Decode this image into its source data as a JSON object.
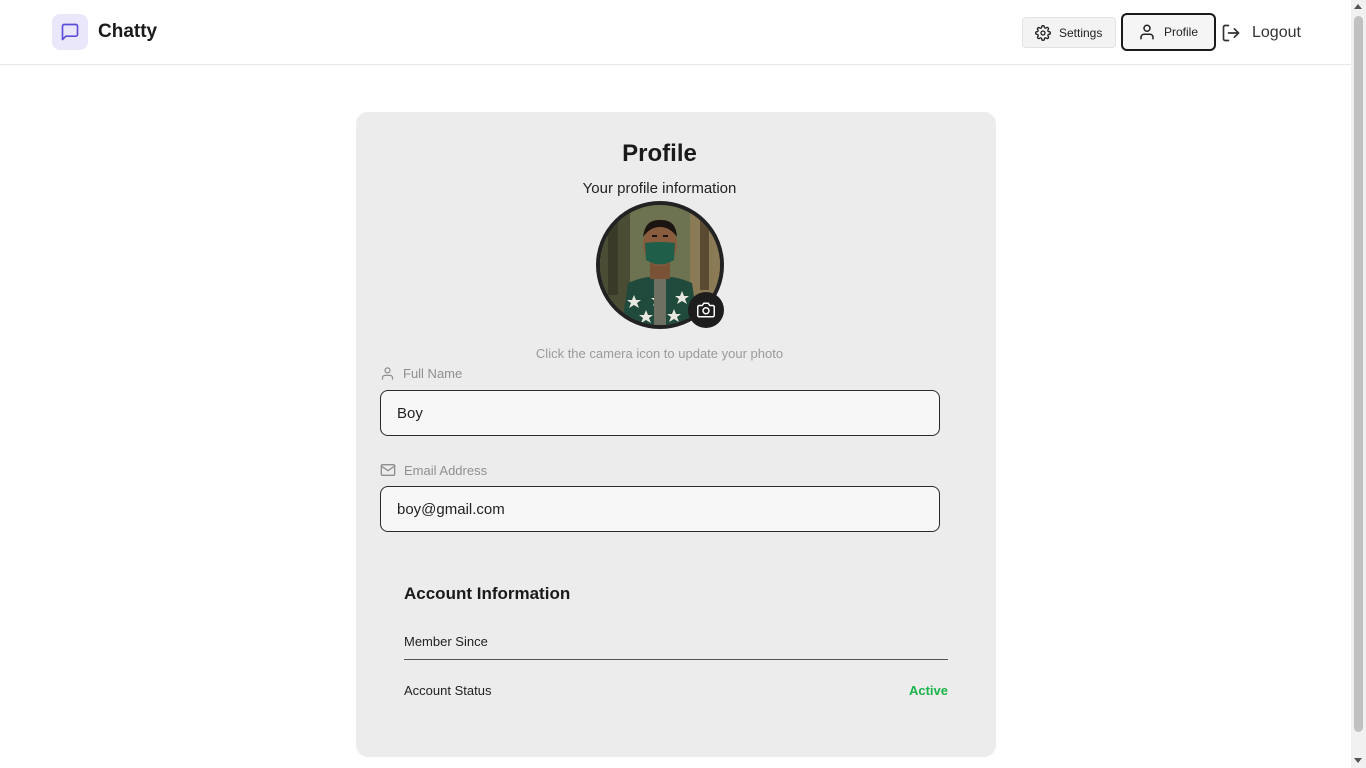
{
  "app": {
    "brand": "Chatty"
  },
  "nav": {
    "settings_label": "Settings",
    "profile_label": "Profile",
    "logout_label": "Logout"
  },
  "profile": {
    "title": "Profile",
    "subtitle": "Your profile information",
    "photo_hint": "Click the camera icon to update your photo",
    "full_name_label": "Full Name",
    "full_name_value": "Boy",
    "email_label": "Email Address",
    "email_value": "boy@gmail.com"
  },
  "account": {
    "title": "Account Information",
    "member_since_label": "Member Since",
    "member_since_value": "",
    "status_label": "Account Status",
    "status_value": "Active"
  },
  "colors": {
    "accent_bg": "#ebe7fb",
    "accent": "#5b4fd9",
    "status_active": "#1bb34a"
  },
  "icons": {
    "logo": "message-square-icon",
    "settings": "gear-icon",
    "profile": "user-icon",
    "logout": "logout-icon",
    "camera": "camera-icon",
    "full_name": "user-icon",
    "email": "mail-icon"
  }
}
